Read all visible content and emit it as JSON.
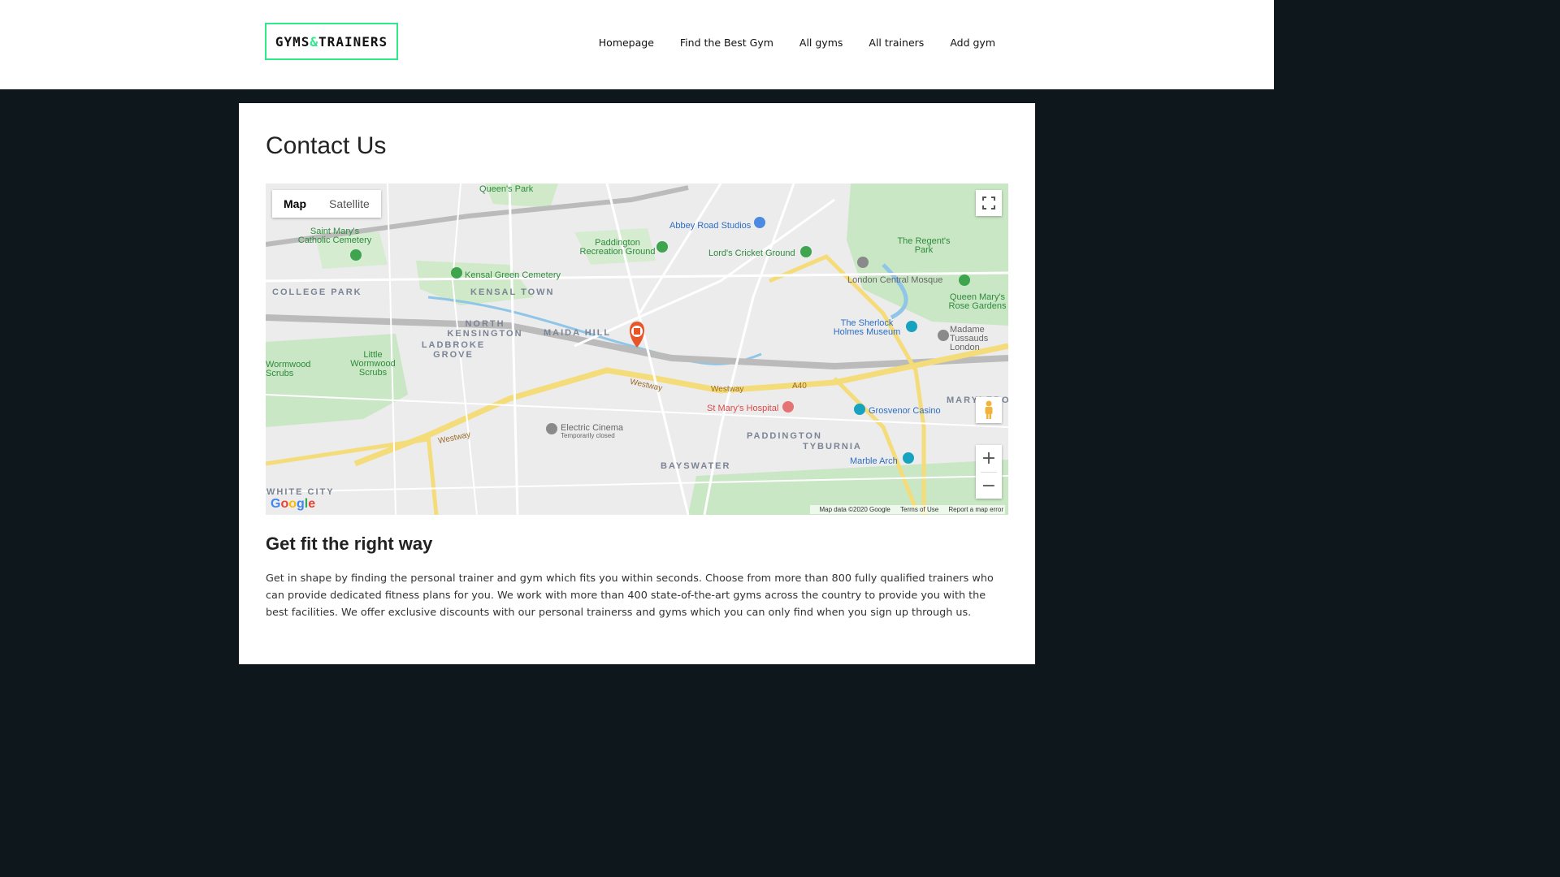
{
  "header": {
    "logo_part1": "GYMS",
    "logo_amp": "&",
    "logo_part2": "TRAINERS",
    "nav": [
      "Homepage",
      "Find the Best Gym",
      "All gyms",
      "All trainers",
      "Add gym"
    ]
  },
  "main": {
    "title": "Contact Us",
    "subtitle": "Get fit the right way",
    "paragraph": "Get in shape by finding the personal trainer and gym which fits you within seconds. Choose from more than 800 fully qualified trainers who can provide dedicated fitness plans for you. We work with more than 400 state-of-the-art gyms across the country to provide you with the best facilities. We offer exclusive discounts with our personal trainerss and gyms which you can only find when you sign up through us."
  },
  "map": {
    "type_map": "Map",
    "type_satellite": "Satellite",
    "fullscreen_icon": "fullscreen-icon",
    "pegman_icon": "pegman-icon",
    "zoom_in": "+",
    "zoom_out": "−",
    "attribution": [
      "Map data ©2020 Google",
      "Terms of Use",
      "Report a map error"
    ],
    "google_logo": "Google",
    "labels": {
      "queens_park": "Queen's Park",
      "abbey_road": "Abbey Road Studios",
      "paddington_rec": "Paddington Recreation Ground",
      "lords": "Lord's Cricket Ground",
      "regents_park": "The Regent's Park",
      "london_mosque": "London Central Mosque",
      "queen_marys": "Queen Mary's Rose Gardens",
      "saint_marys": "Saint Mary's Catholic Cemetery",
      "kensal_green": "Kensal Green Cemetery",
      "kensal_town": "KENSAL TOWN",
      "college_park": "COLLEGE PARK",
      "north_kensington": "NORTH KENSINGTON",
      "maida_hill": "MAIDA HILL",
      "ladbroke_grove": "LADBROKE GROVE",
      "sherlock": "The Sherlock Holmes Museum",
      "madame_tussauds": "Madame Tussauds London",
      "wormwood": "Wormwood Scrubs",
      "little_wormwood": "Little Wormwood Scrubs",
      "westway": "Westway",
      "st_marys_hospital": "St Mary's Hospital",
      "grosvenor": "Grosvenor Casino",
      "electric_cinema": "Electric Cinema",
      "temp_closed": "Temporarily closed",
      "paddington": "PADDINGTON",
      "tyburnia": "TYBURNIA",
      "bayswater": "BAYSWATER",
      "marble_arch": "Marble Arch",
      "white_city": "WHITE CITY",
      "marylebone": "MARYLEBONE",
      "a40": "A40"
    }
  }
}
